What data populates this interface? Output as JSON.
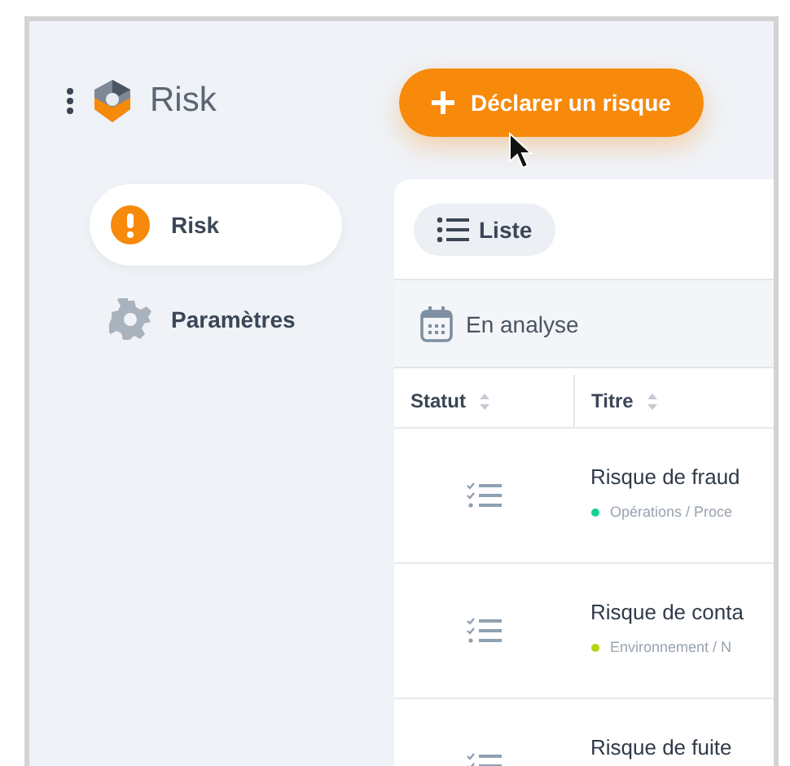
{
  "app": {
    "title": "Risk"
  },
  "nav": [
    {
      "label": "Risk",
      "selected": true,
      "kind": "alert"
    },
    {
      "label": "Paramètres",
      "selected": false,
      "kind": "settings"
    }
  ],
  "action_button": {
    "label": "Déclarer un risque"
  },
  "view_tabs": [
    {
      "label": "Liste",
      "selected": true
    }
  ],
  "group": {
    "label": "En analyse"
  },
  "table": {
    "columns": [
      "Statut",
      "Titre"
    ],
    "rows": [
      {
        "title": "Risque de fraud",
        "category": "Opérations / Proce",
        "color": "#1ccf94"
      },
      {
        "title": "Risque de conta",
        "category": "Environnement / N",
        "color": "#b8d317"
      },
      {
        "title": "Risque de fuite"
      }
    ]
  }
}
